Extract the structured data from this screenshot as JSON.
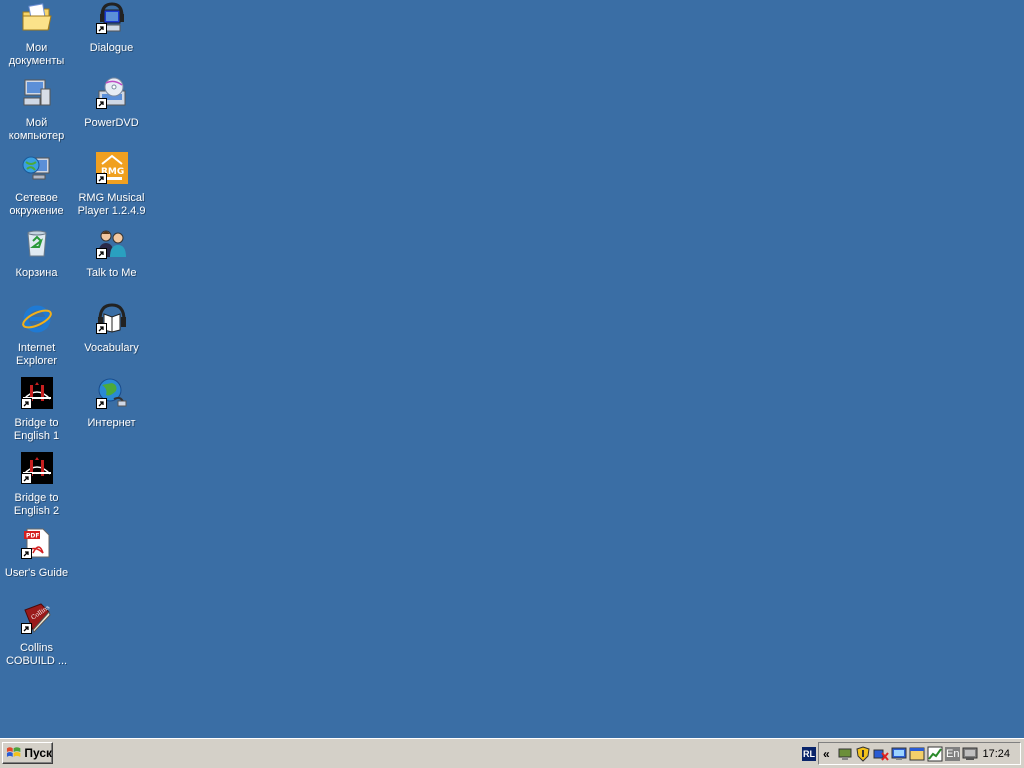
{
  "desktop": {
    "background_color": "#3a6ea5",
    "icons": [
      {
        "id": "my-documents",
        "label": "Мои\nдокументы",
        "icon": "folder-documents-icon",
        "shortcut": false
      },
      {
        "id": "my-computer",
        "label": "Мой\nкомпьютер",
        "icon": "computer-icon",
        "shortcut": false
      },
      {
        "id": "network",
        "label": "Сетевое\nокружение",
        "icon": "network-globe-icon",
        "shortcut": false
      },
      {
        "id": "recycle-bin",
        "label": "Корзина",
        "icon": "recycle-bin-icon",
        "shortcut": false
      },
      {
        "id": "internet-explorer",
        "label": "Internet\nExplorer",
        "icon": "internet-explorer-icon",
        "shortcut": false
      },
      {
        "id": "bridge-1",
        "label": "Bridge to\nEnglish 1",
        "icon": "bridge-icon",
        "shortcut": true
      },
      {
        "id": "bridge-2",
        "label": "Bridge to\nEnglish 2",
        "icon": "bridge-icon",
        "shortcut": true
      },
      {
        "id": "users-guide",
        "label": "User's Guide",
        "icon": "pdf-document-icon",
        "shortcut": true
      },
      {
        "id": "collins",
        "label": "Collins\nCOBUILD ...",
        "icon": "book-icon",
        "shortcut": true
      },
      {
        "id": "dialogue",
        "label": "Dialogue",
        "icon": "headset-monitor-icon",
        "shortcut": true
      },
      {
        "id": "powerdvd",
        "label": "PowerDVD",
        "icon": "dvd-icon",
        "shortcut": true
      },
      {
        "id": "rmg",
        "label": "RMG Musical\nPlayer 1.2.4.9",
        "icon": "rmg-player-icon",
        "shortcut": true
      },
      {
        "id": "talk-to-me",
        "label": "Talk to Me",
        "icon": "people-talking-icon",
        "shortcut": true
      },
      {
        "id": "vocabulary",
        "label": "Vocabulary",
        "icon": "headphones-book-icon",
        "shortcut": true
      },
      {
        "id": "internet",
        "label": "Интернет",
        "icon": "globe-connection-icon",
        "shortcut": true
      }
    ]
  },
  "taskbar": {
    "start_label": "Пуск",
    "lang_label": "RL",
    "expand_glyph": "«",
    "en_label": "En",
    "clock": "17:24"
  }
}
